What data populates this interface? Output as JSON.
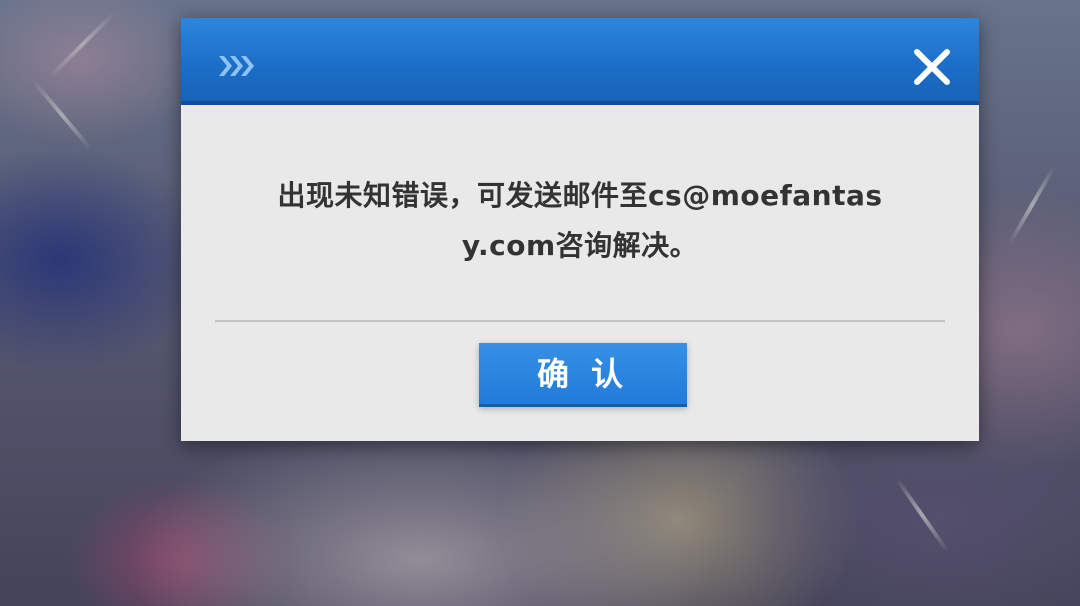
{
  "dialog": {
    "message_line1": "出现未知错误，可发送邮件至cs@moefantas",
    "message_line2": "y.com咨询解决。",
    "confirm_label": "确认",
    "header_icon": "chevrons-right-icon",
    "close_icon": "close-icon"
  },
  "colors": {
    "header": "#1c6fc8",
    "button": "#217bd8",
    "body": "#e9e9ea",
    "text": "#333333"
  }
}
